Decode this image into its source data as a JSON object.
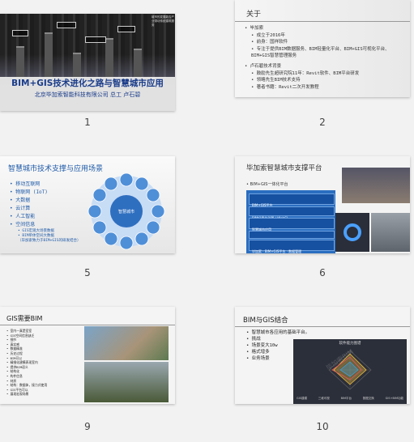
{
  "slides": [
    {
      "number": "1",
      "title": "BIM+GIS技术进化之路与智慧城市应用",
      "subtitle": "北京毕加索智能科技有限公司 总工 卢石碧",
      "corner_text": "城市的发展能否产业带动传统建筑服务"
    },
    {
      "number": "2",
      "title": "关于",
      "groups": [
        {
          "label": "• 毕加索",
          "items": [
            "• 成立于2016年",
            "• 前身：国祥软件",
            "• 专注于提供BIM数据服务、BIM轻量化平台、BIM+GIS可视化平台、BIM+GIS智慧管理服务"
          ]
        },
        {
          "label": "• 卢石碧技术背景",
          "items": [
            "• 鼓励先生超研究院11年：Revit软件、BIM平台研发",
            "• 领略先生BIM技术支持",
            "• 著者书籍：Revit二次开发教程"
          ]
        }
      ]
    },
    {
      "number": "5",
      "title": "智慧城市技术支撑与应用场景",
      "items": [
        "• 移动互联网",
        "• 物联网 (IoT)",
        "• 大数据",
        "• 云计算",
        "• 人工智能",
        "• 空间信息"
      ],
      "subitems": [
        "• GIS宏观大场景数据",
        "• BIM单体空间大数据",
        "（毕加索致力于BIM+GIS的研发结合）"
      ],
      "center_label": "智慧城市"
    },
    {
      "number": "6",
      "title": "毕加索智慧城市支撑平台",
      "subtitle": "• BIM+GIS一体化平台",
      "panel_rows": [
        "BIM+GIS平台",
        "BIM轻量化引擎 | WebGL",
        "智慧城市应用",
        "运维 · 数据平台",
        "毕加索 · BIM+GIS平台 · 数据管理"
      ]
    },
    {
      "number": "9",
      "title": "GIS需要BIM",
      "items": [
        "• 室内一真是室室",
        "• GIS空间信息缺乏",
        "  • 细节",
        "  • 真实感",
        "  • 数据精准",
        "  • 历史过程",
        "",
        "• BIM可以",
        "  • 精细化建模表现室内",
        "  • 提供BIM语义",
        "    • 结构化",
        "    • 构件信息",
        "    • 材质",
        "  • 结构：数据体，接力式使用",
        "  • GIS平台可以",
        "    • 展现宏观场景"
      ]
    },
    {
      "number": "10",
      "title": "BIM与GIS结合",
      "items": [
        "• 智慧城市各应用的基础平台。",
        "• 挑战",
        "  • 场景变大10w",
        "  • 格式增多",
        "  • 业务场景"
      ],
      "radar": {
        "title": "软件能力图谱",
        "legend": [
          "GIS建模",
          "三维可视",
          "BIM平台",
          "数据交换",
          "GIS+BIM功能"
        ]
      },
      "watermark": "毕加索BIM"
    }
  ]
}
